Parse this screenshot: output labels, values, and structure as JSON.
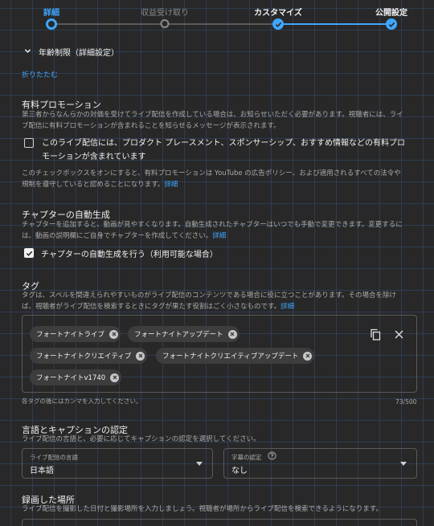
{
  "stepper": {
    "steps": [
      {
        "label": "詳細",
        "state": "active"
      },
      {
        "label": "収益受け取り",
        "state": "inactive"
      },
      {
        "label": "カスタマイズ",
        "state": "done"
      },
      {
        "label": "公開設定",
        "state": "done"
      }
    ]
  },
  "age_restriction": {
    "title": "年齢制限（詳細設定）"
  },
  "collapse_link": "折りたたむ",
  "paid_promotion": {
    "title": "有料プロモーション",
    "desc1": "第三者からなんらかの対価を受けてライブ配信を作成している場合は、お知らせいただく必要があります。視聴者には、ライ",
    "desc2": "ブ配信に有料プロモーションが含まれることを知らせるメッセージが表示されます。",
    "checkbox_label_1": "このライブ配信には、プロダクト プレースメント、スポンサーシップ、おすすめ情報などの有料プロ",
    "checkbox_label_2": "モーションが含まれています",
    "checked": false,
    "note1": "このチェックボックスをオンにすると、有料プロモーションは YouTube の広告ポリシー、および適用されるすべての法令や",
    "note2": "規制を遵守していると認めることになります。",
    "note_link": "詳細"
  },
  "chapters": {
    "title": "チャプターの自動生成",
    "desc1": "チャプターを追加すると、動画が見やすくなります。自動生成されたチャプターはいつでも手動で変更できます。変更するに",
    "desc2": "は、動画の説明欄にご自身でチャプターを作成してください。",
    "desc_link": "詳細",
    "checkbox_label": "チャプターの自動生成を行う（利用可能な場合）",
    "checked": true
  },
  "tags": {
    "title": "タグ",
    "desc1": "タグは、スペルを間違えられやすいものがライブ配信のコンテンツである場合に役に立つことがあります。その場合を除け",
    "desc2": "ば、視聴者がライブ配信を検索するときにタグが果たす役割はごく小さなものです。",
    "desc_link": "詳細",
    "chips": [
      "フォートナイトライブ",
      "フォートナイトアップデート",
      "フォートナイトクリエイティブ",
      "フォートナイトクリエイティブアップデート",
      "フォートナイトv1740"
    ],
    "hint": "各タグの後にはカンマを入力してください。",
    "counter": "73/500"
  },
  "language": {
    "title": "言語とキャプションの認定",
    "desc": "ライブ配信の言語と、必要に応じてキャプションの認定を選択してください。",
    "stream_lang_label": "ライブ配信の言語",
    "stream_lang_value": "日本語",
    "caption_label": "字幕の認定",
    "caption_value": "なし"
  },
  "location": {
    "title": "録画した場所",
    "desc": "ライブ配信を撮影した日付と撮影場所を入力しましょう。視聴者が場所からライブ配信を検索できるようになります。"
  },
  "colors": {
    "accent": "#3ea6ff",
    "background": "#282828",
    "text": "#f1f1f1",
    "muted": "#aaaaaa"
  }
}
